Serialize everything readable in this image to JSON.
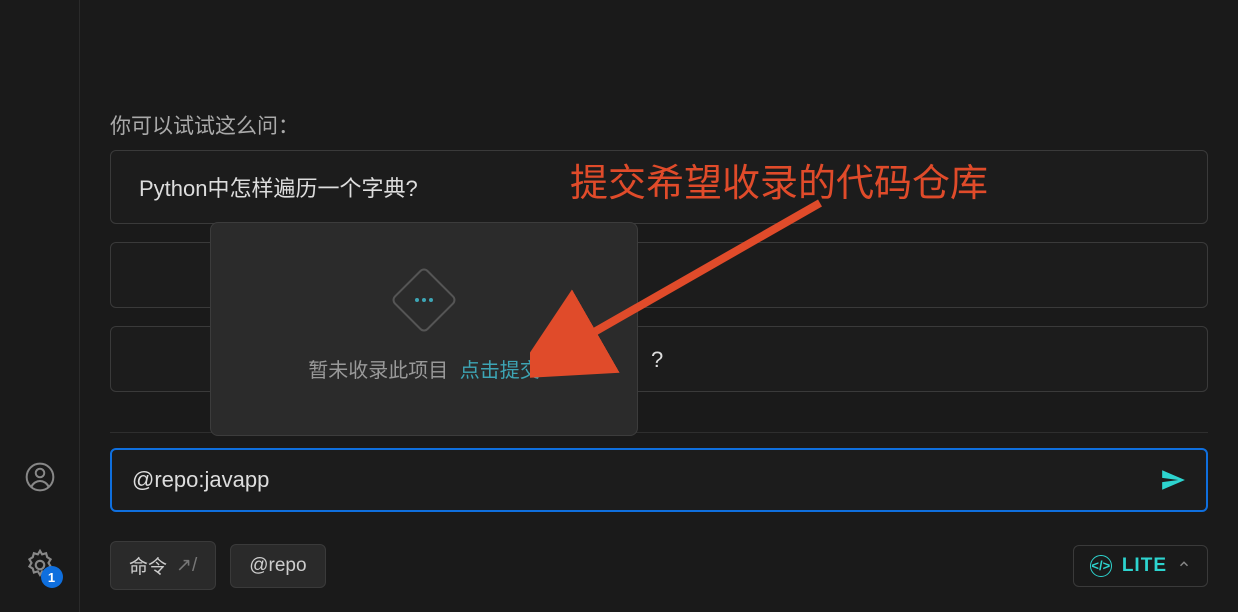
{
  "sidebar": {
    "badge_count": "1"
  },
  "suggestions": {
    "label": "你可以试试这么问：",
    "items": [
      "Python中怎样遍历一个字典?",
      "",
      "?"
    ]
  },
  "popup": {
    "message": "暂未收录此项目",
    "link_text": "点击提交"
  },
  "annotation": {
    "text": "提交希望收录的代码仓库",
    "color": "#e04b2a"
  },
  "input": {
    "value": "@repo:javapp"
  },
  "chips": {
    "command": "命令",
    "command_suffix": "/",
    "repo": "@repo"
  },
  "mode": {
    "label": "LITE"
  }
}
